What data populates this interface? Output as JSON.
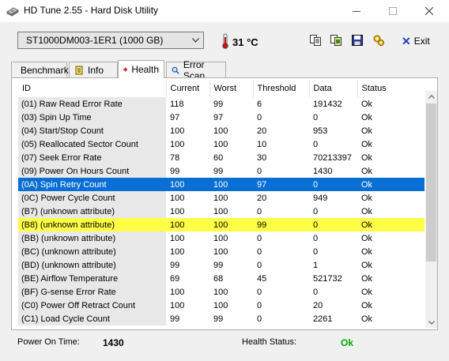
{
  "window": {
    "title": "HD Tune 2.55 - Hard Disk Utility"
  },
  "toolbar": {
    "drive": "ST1000DM003-1ER1 (1000 GB)",
    "temperature": "31 °C",
    "exit_label": "Exit",
    "icons": [
      "copy-icon",
      "copy-info-icon",
      "save-icon",
      "options-icon"
    ]
  },
  "tabs": [
    {
      "label": "Benchmark",
      "icon": "benchmark-icon"
    },
    {
      "label": "Info",
      "icon": "info-icon"
    },
    {
      "label": "Health",
      "icon": "health-icon",
      "active": true
    },
    {
      "label": "Error Scan",
      "icon": "error-scan-icon"
    }
  ],
  "table": {
    "columns": [
      "ID",
      "Current",
      "Worst",
      "Threshold",
      "Data",
      "Status"
    ],
    "rows": [
      [
        "(01) Raw Read Error Rate",
        "118",
        "99",
        "6",
        "191432",
        "Ok"
      ],
      [
        "(03) Spin Up Time",
        "97",
        "97",
        "0",
        "0",
        "Ok"
      ],
      [
        "(04) Start/Stop Count",
        "100",
        "100",
        "20",
        "953",
        "Ok"
      ],
      [
        "(05) Reallocated Sector Count",
        "100",
        "100",
        "10",
        "0",
        "Ok"
      ],
      [
        "(07) Seek Error Rate",
        "78",
        "60",
        "30",
        "70213397",
        "Ok"
      ],
      [
        "(09) Power On Hours Count",
        "99",
        "99",
        "0",
        "1430",
        "Ok"
      ],
      [
        "(0A) Spin Retry Count",
        "100",
        "100",
        "97",
        "0",
        "Ok"
      ],
      [
        "(0C) Power Cycle Count",
        "100",
        "100",
        "20",
        "949",
        "Ok"
      ],
      [
        "(B7) (unknown attribute)",
        "100",
        "100",
        "0",
        "0",
        "Ok"
      ],
      [
        "(B8) (unknown attribute)",
        "100",
        "100",
        "99",
        "0",
        "Ok"
      ],
      [
        "(BB) (unknown attribute)",
        "100",
        "100",
        "0",
        "0",
        "Ok"
      ],
      [
        "(BC) (unknown attribute)",
        "100",
        "100",
        "0",
        "0",
        "Ok"
      ],
      [
        "(BD) (unknown attribute)",
        "99",
        "99",
        "0",
        "1",
        "Ok"
      ],
      [
        "(BE) Airflow Temperature",
        "69",
        "68",
        "45",
        "521732",
        "Ok"
      ],
      [
        "(BF) G-sense Error Rate",
        "100",
        "100",
        "0",
        "0",
        "Ok"
      ],
      [
        "(C0) Power Off Retract Count",
        "100",
        "100",
        "0",
        "20",
        "Ok"
      ],
      [
        "(C1) Load Cycle Count",
        "99",
        "99",
        "0",
        "2261",
        "Ok"
      ]
    ],
    "selected_row": 6,
    "highlighted_row": 9,
    "selected_color": "#0a6fd4",
    "highlight_color": "#ffff46"
  },
  "status": {
    "power_on_label": "Power On Time:",
    "power_on_value": "1430",
    "health_label": "Health Status:",
    "health_value": "Ok",
    "health_color": "#00aa00"
  }
}
